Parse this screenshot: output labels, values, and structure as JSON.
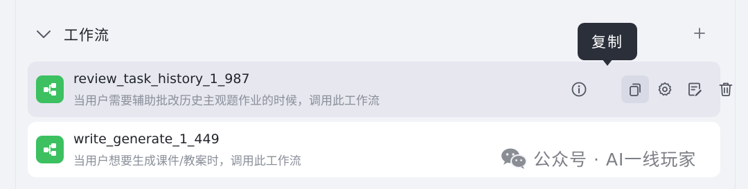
{
  "section": {
    "title": "工作流",
    "chevron_icon": "chevron-down-icon",
    "add_icon": "plus-icon"
  },
  "workflows": [
    {
      "name": "review_task_history_1_987",
      "description": "当用户需要辅助批改历史主观题作业的时候，调用此工作流",
      "icon": "workflow-icon",
      "hovered": true
    },
    {
      "name": "write_generate_1_449",
      "description": "当用户想要生成课件/教案时，调用此工作流",
      "icon": "workflow-icon",
      "hovered": false
    }
  ],
  "actions": [
    "info-icon",
    "copy-icon",
    "settings-icon",
    "edit-icon",
    "delete-icon"
  ],
  "tooltip": {
    "label": "复制"
  },
  "watermark": {
    "text": "公众号 · AI一线玩家",
    "icon": "wechat-icon"
  },
  "colors": {
    "background": "#f2f3f7",
    "card_hover": "#e6e7ef",
    "card": "#ffffff",
    "icon_green": "#3cc060",
    "tooltip_bg": "#2b2f3a"
  }
}
